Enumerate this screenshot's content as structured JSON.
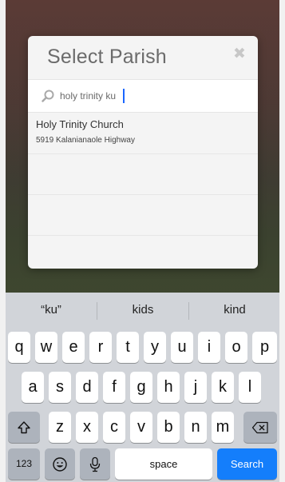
{
  "dialog": {
    "title": "Select Parish",
    "close_glyph": "✖"
  },
  "search": {
    "value": "holy trinity ku",
    "icon": "search-icon"
  },
  "results": [
    {
      "name": "Holy Trinity Church",
      "address": "5919 Kalanianaole Highway"
    }
  ],
  "keyboard": {
    "suggestions": [
      "“ku”",
      "kids",
      "kind"
    ],
    "row1": [
      "q",
      "w",
      "e",
      "r",
      "t",
      "y",
      "u",
      "i",
      "o",
      "p"
    ],
    "row2": [
      "a",
      "s",
      "d",
      "f",
      "g",
      "h",
      "j",
      "k",
      "l"
    ],
    "row3": [
      "z",
      "x",
      "c",
      "v",
      "b",
      "n",
      "m"
    ],
    "numbers_label": "123",
    "space_label": "space",
    "search_label": "Search",
    "shift_icon": "shift-icon",
    "backspace_icon": "backspace-icon",
    "emoji_icon": "emoji-icon",
    "mic_icon": "microphone-icon"
  },
  "colors": {
    "search_key": "#147efb",
    "caret": "#1a66ff"
  }
}
